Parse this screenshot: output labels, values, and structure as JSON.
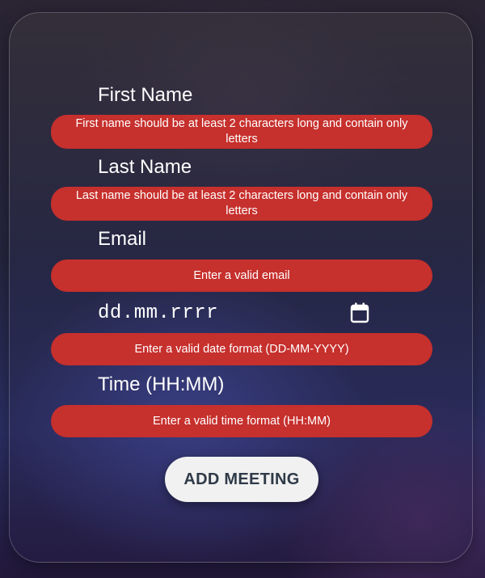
{
  "form": {
    "first_name": {
      "label": "First Name",
      "error": "First name should be at least 2 characters long and contain only letters"
    },
    "last_name": {
      "label": "Last Name",
      "error": "Last name should be at least 2 characters long and contain only letters"
    },
    "email": {
      "label": "Email",
      "error": "Enter a valid email"
    },
    "date": {
      "value": "dd.mm.rrrr",
      "icon": "calendar-icon",
      "error": "Enter a valid date format (DD-MM-YYYY)"
    },
    "time": {
      "label": "Time (HH:MM)",
      "error": "Enter a valid time format (HH:MM)"
    },
    "submit_label": "ADD MEETING"
  },
  "colors": {
    "error_bg": "#c6302d",
    "button_bg": "#f1f1f1",
    "button_text": "#2f3a48"
  }
}
